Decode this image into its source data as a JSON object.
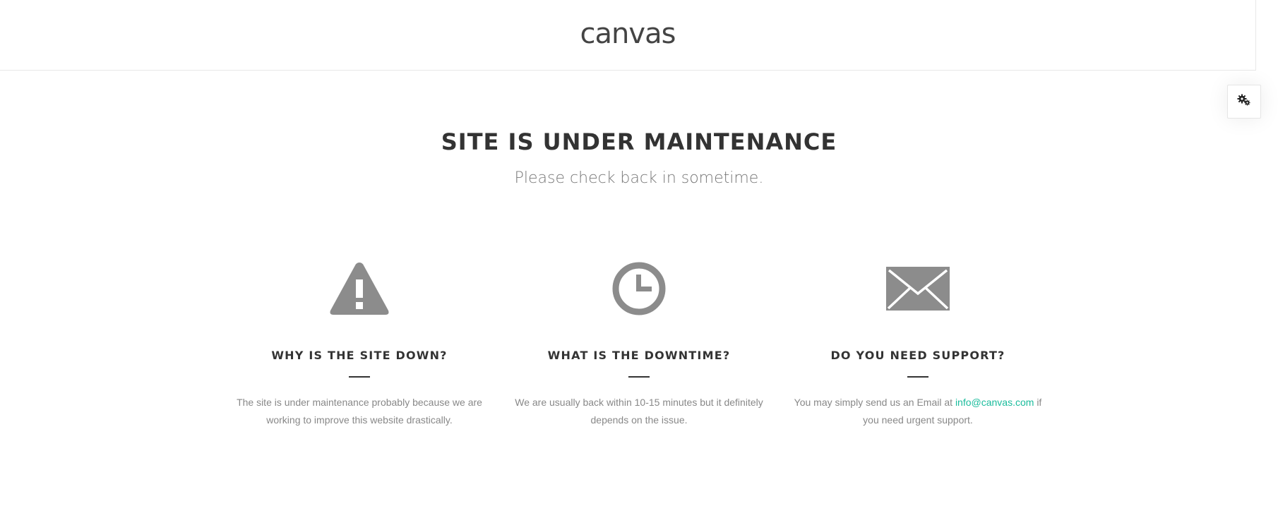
{
  "header": {
    "logo": "canvas"
  },
  "main": {
    "title": "SITE IS UNDER MAINTENANCE",
    "subtitle": "Please check back in sometime."
  },
  "features": [
    {
      "icon": "warning-icon",
      "title": "WHY IS THE SITE DOWN?",
      "text": "The site is under maintenance probably because we are working to improve this website drastically."
    },
    {
      "icon": "clock-icon",
      "title": "WHAT IS THE DOWNTIME?",
      "text": "We are usually back within 10-15 minutes but it definitely depends on the issue."
    },
    {
      "icon": "envelope-icon",
      "title": "DO YOU NEED SUPPORT?",
      "text_before": "You may simply send us an Email at",
      "email": "info@canvas.com",
      "text_after": "if you need urgent support."
    }
  ],
  "colors": {
    "icon": "#8c8c8c",
    "link": "#1ABC9C",
    "heading": "#333333"
  },
  "settings": {
    "icon": "gears-icon"
  }
}
